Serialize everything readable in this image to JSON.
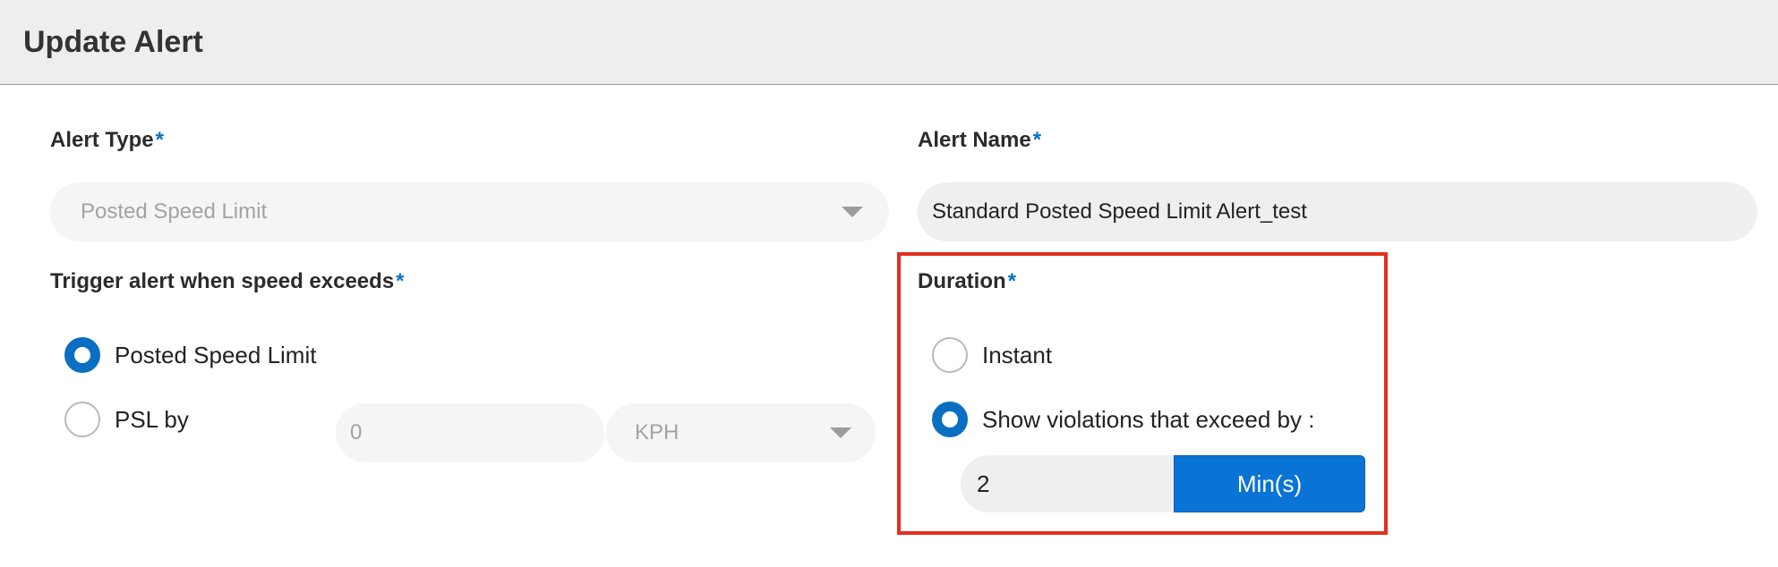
{
  "header": {
    "title": "Update Alert"
  },
  "required_marker": "*",
  "alert_type": {
    "label": "Alert Type",
    "value": "Posted Speed Limit"
  },
  "alert_name": {
    "label": "Alert Name",
    "value": "Standard Posted Speed Limit Alert_test"
  },
  "trigger": {
    "label": "Trigger alert when speed exceeds",
    "options": [
      {
        "label": "Posted Speed Limit",
        "checked": true
      },
      {
        "label": "PSL by",
        "checked": false
      }
    ],
    "psl_value": "0",
    "psl_unit": "KPH"
  },
  "duration": {
    "label": "Duration",
    "options": [
      {
        "label": "Instant",
        "checked": false
      },
      {
        "label": "Show violations that exceed by :",
        "checked": true
      }
    ],
    "value": "2",
    "unit_label": "Min(s)"
  },
  "colors": {
    "accent": "#0a74d6",
    "highlight_border": "#e0301e",
    "header_bg": "#eeeeee"
  }
}
